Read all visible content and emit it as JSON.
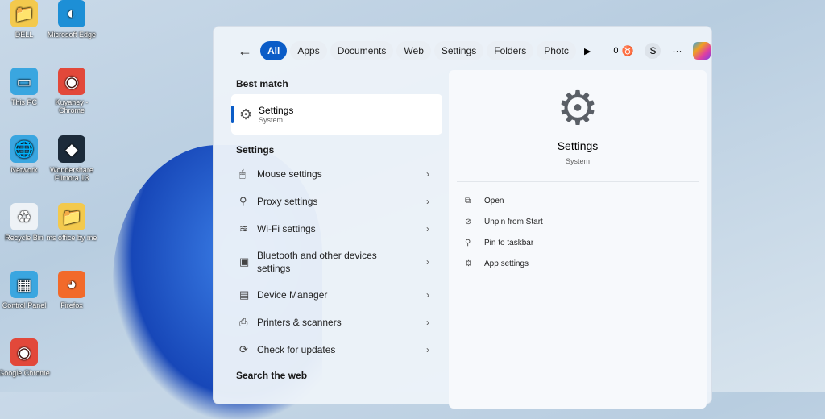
{
  "desktop": [
    {
      "label": "DELL",
      "icon": "folder-user-icon"
    },
    {
      "label": "Microsoft Edge",
      "icon": "edge-icon"
    },
    {
      "label": "This PC",
      "icon": "monitor-icon"
    },
    {
      "label": "Kuyaney - Chrome",
      "icon": "chrome-profile-icon"
    },
    {
      "label": "Network",
      "icon": "network-icon"
    },
    {
      "label": "Wondershare Filmora 13",
      "icon": "filmora-icon"
    },
    {
      "label": "Recycle Bin",
      "icon": "recycle-bin-icon"
    },
    {
      "label": "ms office by me",
      "icon": "folder-icon"
    },
    {
      "label": "Control Panel",
      "icon": "control-panel-icon"
    },
    {
      "label": "Firefox",
      "icon": "firefox-icon"
    },
    {
      "label": "Google Chrome",
      "icon": "chrome-icon"
    }
  ],
  "search": {
    "tabs": [
      "All",
      "Apps",
      "Documents",
      "Web",
      "Settings",
      "Folders",
      "Photc"
    ],
    "points": "0",
    "avatar": "S",
    "more": "···",
    "best_match_heading": "Best match",
    "best": {
      "title": "Settings",
      "subtitle": "System"
    },
    "settings_heading": "Settings",
    "items": [
      {
        "label": "Mouse settings",
        "icon": "mouse-icon"
      },
      {
        "label": "Proxy settings",
        "icon": "proxy-icon"
      },
      {
        "label": "Wi-Fi settings",
        "icon": "wifi-icon"
      },
      {
        "label": "Bluetooth and other devices settings",
        "icon": "bluetooth-icon"
      },
      {
        "label": "Device Manager",
        "icon": "device-manager-icon"
      },
      {
        "label": "Printers & scanners",
        "icon": "printer-icon"
      },
      {
        "label": "Check for updates",
        "icon": "update-icon"
      }
    ],
    "web_heading": "Search the web",
    "preview": {
      "title": "Settings",
      "subtitle": "System"
    },
    "actions": [
      {
        "label": "Open",
        "icon": "open-icon"
      },
      {
        "label": "Unpin from Start",
        "icon": "unpin-icon"
      },
      {
        "label": "Pin to taskbar",
        "icon": "pin-icon"
      },
      {
        "label": "App settings",
        "icon": "gear-icon"
      }
    ],
    "accent": "#0a5cc7"
  }
}
